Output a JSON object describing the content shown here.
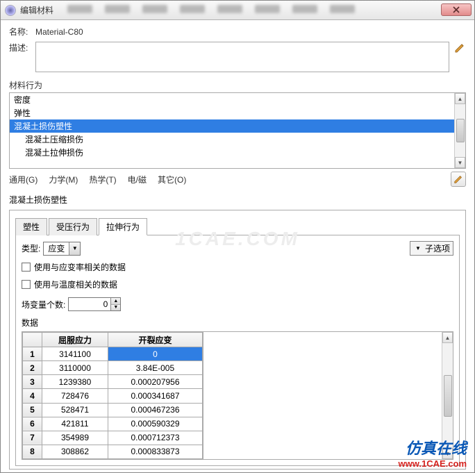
{
  "window": {
    "title": "编辑材料"
  },
  "form": {
    "name_label": "名称:",
    "name_value": "Material-C80",
    "desc_label": "描述:",
    "desc_value": ""
  },
  "behaviors": {
    "section_label": "材料行为",
    "items": [
      {
        "label": "密度",
        "indent": false,
        "selected": false
      },
      {
        "label": "弹性",
        "indent": false,
        "selected": false
      },
      {
        "label": "混凝土损伤塑性",
        "indent": false,
        "selected": true
      },
      {
        "label": "混凝土压缩损伤",
        "indent": true,
        "selected": false
      },
      {
        "label": "混凝土拉伸损伤",
        "indent": true,
        "selected": false
      }
    ]
  },
  "menus": {
    "general": "通用(G)",
    "mechanical": "力学(M)",
    "thermal": "热学(T)",
    "emag": "电/磁",
    "other": "其它(O)"
  },
  "damage": {
    "section_label": "混凝土损伤塑性",
    "tabs": [
      {
        "label": "塑性",
        "active": false
      },
      {
        "label": "受压行为",
        "active": false
      },
      {
        "label": "拉伸行为",
        "active": true
      }
    ],
    "type_label": "类型:",
    "type_value": "应变",
    "suboptions_label": "子选项",
    "chk_strainrate": "使用与应变率相关的数据",
    "chk_temperature": "使用与温度相关的数据",
    "fieldvar_label": "场变量个数:",
    "fieldvar_value": "0",
    "data_label": "数据",
    "columns": [
      "屈服应力",
      "开裂应变"
    ],
    "rows": [
      {
        "n": "1",
        "a": "3141100",
        "b": "0",
        "bsel": true
      },
      {
        "n": "2",
        "a": "3110000",
        "b": "3.84E-005"
      },
      {
        "n": "3",
        "a": "1239380",
        "b": "0.000207956"
      },
      {
        "n": "4",
        "a": "728476",
        "b": "0.000341687"
      },
      {
        "n": "5",
        "a": "528471",
        "b": "0.000467236"
      },
      {
        "n": "6",
        "a": "421811",
        "b": "0.000590329"
      },
      {
        "n": "7",
        "a": "354989",
        "b": "0.000712373"
      },
      {
        "n": "8",
        "a": "308862",
        "b": "0.000833873"
      }
    ]
  },
  "watermark": {
    "center": "1CAE.COM",
    "brand": "仿真在线",
    "url": "www.1CAE.com"
  }
}
